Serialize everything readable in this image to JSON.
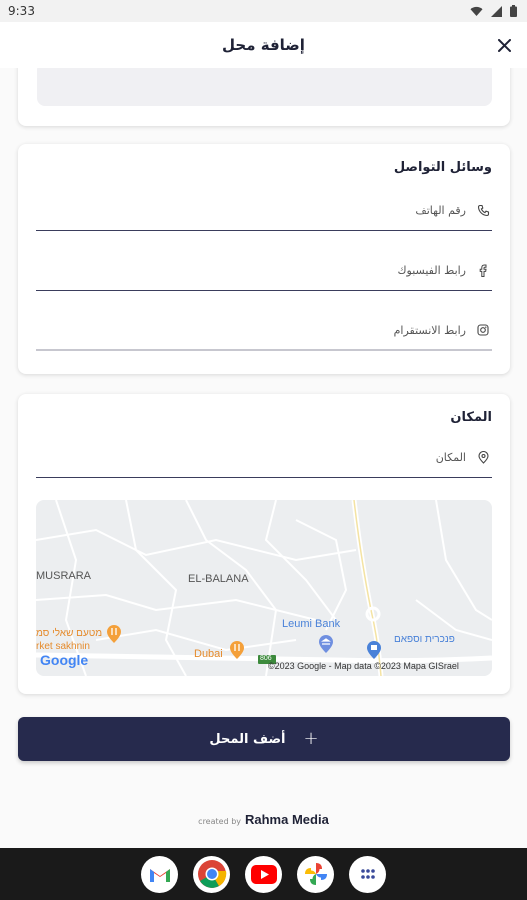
{
  "status": {
    "time": "9:33"
  },
  "header": {
    "title": "إضافة محل"
  },
  "contacts": {
    "title": "وسائل التواصل",
    "phone_placeholder": "رقم الهاتف",
    "facebook_placeholder": "رابط الفيسبوك",
    "instagram_placeholder": "رابط الانستقرام"
  },
  "location": {
    "title": "المكان",
    "place_placeholder": "المكان",
    "map": {
      "labels": [
        "MUSRARA",
        "EL-BALANA",
        "Leumi Bank",
        "Dubai",
        "מטעם שאלי סמ",
        "rket sakhnin",
        "פנכרית וספאם"
      ],
      "logo": "Google",
      "attribution": "©2023 Google - Map data ©2023 Mapa GISrael",
      "road_sign": "806"
    }
  },
  "submit": {
    "label": "أضف المحل",
    "icon": "plus-icon"
  },
  "footer": {
    "created_by": "created by",
    "brand": "Rahma Media"
  },
  "colors": {
    "primary": "#262a4d",
    "accent_red": "#ea4335",
    "accent_orange": "#f4a03a",
    "map_blue": "#4a82d8"
  }
}
